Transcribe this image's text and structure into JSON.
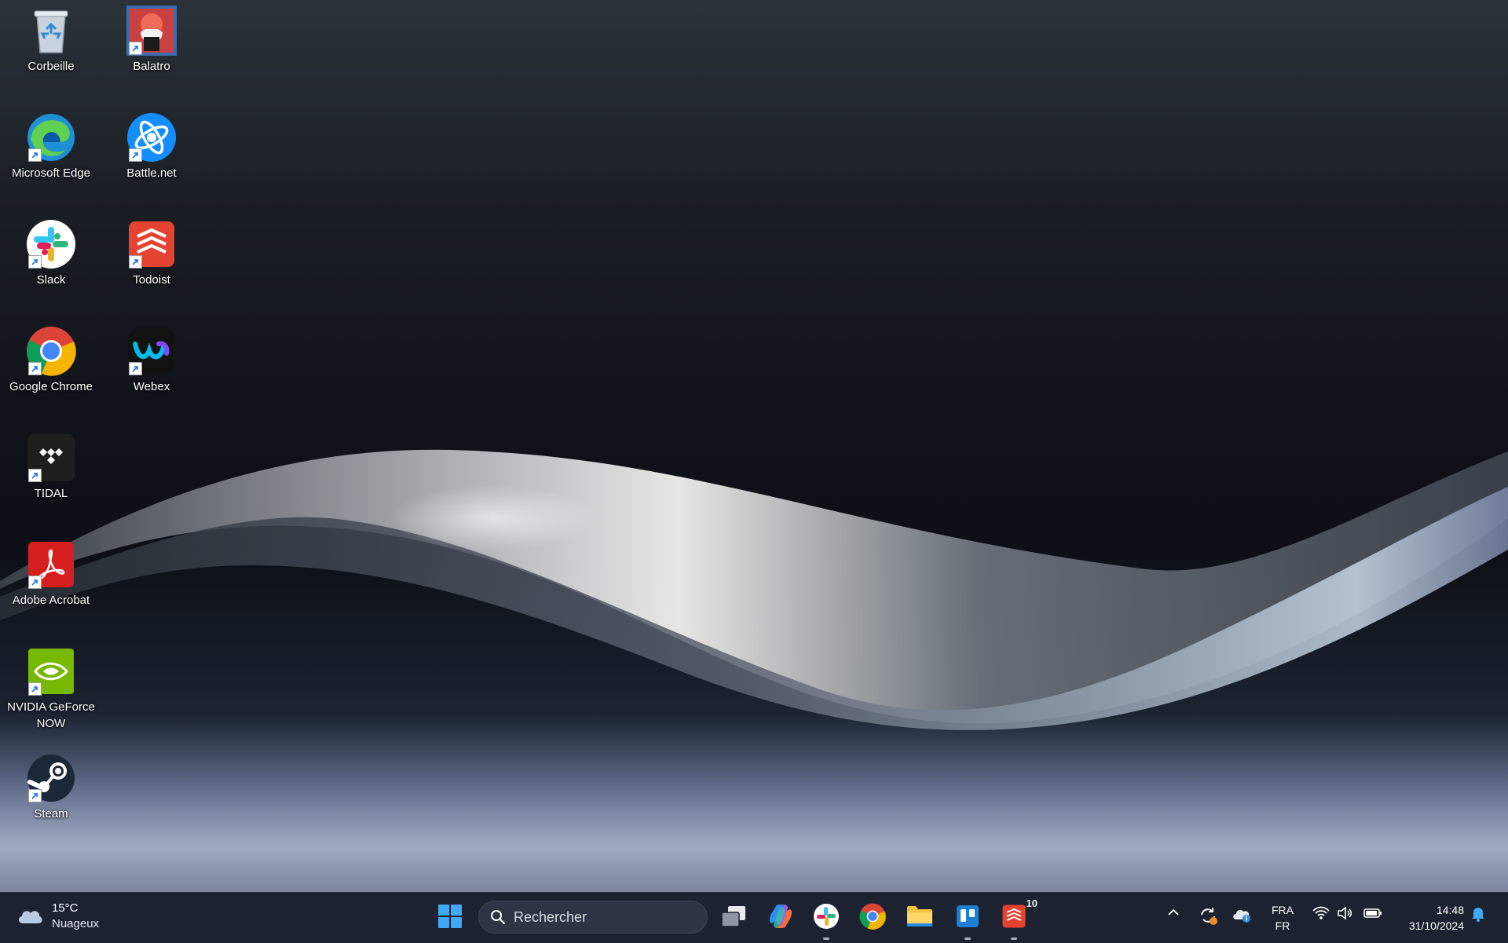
{
  "desktop": {
    "icons": [
      {
        "label": "Corbeille",
        "icon": "recycle-bin-icon"
      },
      {
        "label": "Balatro",
        "icon": "balatro-icon"
      },
      {
        "label": "Microsoft Edge",
        "icon": "edge-icon"
      },
      {
        "label": "Battle.net",
        "icon": "battlenet-icon"
      },
      {
        "label": "Slack",
        "icon": "slack-icon"
      },
      {
        "label": "Todoist",
        "icon": "todoist-icon"
      },
      {
        "label": "Google Chrome",
        "icon": "chrome-icon"
      },
      {
        "label": "Webex",
        "icon": "webex-icon"
      },
      {
        "label": "TIDAL",
        "icon": "tidal-icon"
      },
      {
        "label": "Adobe Acrobat",
        "icon": "acrobat-icon"
      },
      {
        "label": "NVIDIA GeForce NOW",
        "icon": "geforce-now-icon"
      },
      {
        "label": "Steam",
        "icon": "steam-icon"
      }
    ]
  },
  "taskbar": {
    "weather": {
      "temp": "15°C",
      "condition": "Nuageux"
    },
    "search_placeholder": "Rechercher",
    "apps": [
      {
        "name": "task-view",
        "icon": "task-view-icon"
      },
      {
        "name": "copilot",
        "icon": "copilot-icon"
      },
      {
        "name": "slack",
        "icon": "slack-icon"
      },
      {
        "name": "chrome",
        "icon": "chrome-icon"
      },
      {
        "name": "file-explorer",
        "icon": "folder-icon"
      },
      {
        "name": "trello",
        "icon": "trello-icon"
      },
      {
        "name": "todoist",
        "icon": "todoist-icon",
        "badge": "10"
      }
    ],
    "language": {
      "line1": "FRA",
      "line2": "FR"
    },
    "time": "14:48",
    "date": "31/10/2024"
  },
  "colors": {
    "taskbar_bg": "#1c2230",
    "accent": "#0078d4"
  }
}
